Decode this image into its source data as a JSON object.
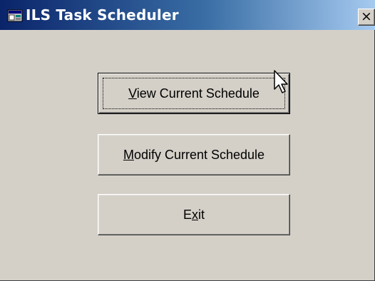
{
  "window": {
    "title": "ILS Task Scheduler",
    "close_glyph": "×",
    "icon": "app-window-icon"
  },
  "buttons": [
    {
      "label_mnemonic": "V",
      "label_rest": "iew Current Schedule",
      "is_default": true
    },
    {
      "label_mnemonic": "M",
      "label_rest": "odify Current Schedule",
      "is_default": false
    },
    {
      "label_before": "E",
      "label_mnemonic": "x",
      "label_rest": "it",
      "is_default": false
    }
  ],
  "colors": {
    "face": "#d4d0c8",
    "title_start": "#0a246a",
    "title_end": "#a6caf0",
    "title_text": "#ffffff"
  }
}
